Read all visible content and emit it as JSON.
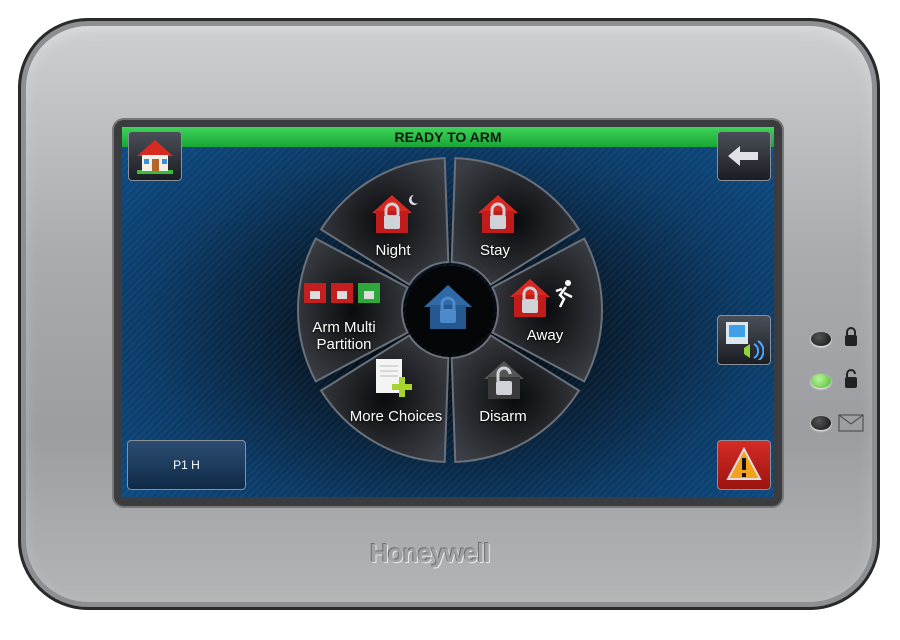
{
  "status": {
    "text": "READY TO ARM",
    "color": "#22b43c"
  },
  "header": {
    "home_icon": "home-icon",
    "back_icon": "back-arrow-icon"
  },
  "wheel": {
    "center_icon": "house-lock-icon",
    "segments": [
      {
        "label": "Night",
        "icon": "house-lock-moon-icon"
      },
      {
        "label": "Stay",
        "icon": "house-lock-icon"
      },
      {
        "label": "Away",
        "icon": "house-lock-running-icon"
      },
      {
        "label": "Disarm",
        "icon": "house-unlock-icon"
      },
      {
        "label": "More Choices",
        "icon": "document-plus-icon"
      },
      {
        "label": "Arm Multi\nPartition",
        "icon": "partition-locks-icon"
      }
    ]
  },
  "partition_button": {
    "label": "P1  H"
  },
  "side_buttons": {
    "voice_icon": "monitor-speaker-icon",
    "panic_icon": "warning-icon",
    "panic_color": "#c8201e"
  },
  "indicators": [
    {
      "icon": "lock-icon",
      "on": false
    },
    {
      "icon": "unlock-icon",
      "on": true,
      "color": "#5fcf3a"
    },
    {
      "icon": "envelope-icon",
      "on": false
    }
  ],
  "brand": {
    "name": "Honeywell"
  }
}
